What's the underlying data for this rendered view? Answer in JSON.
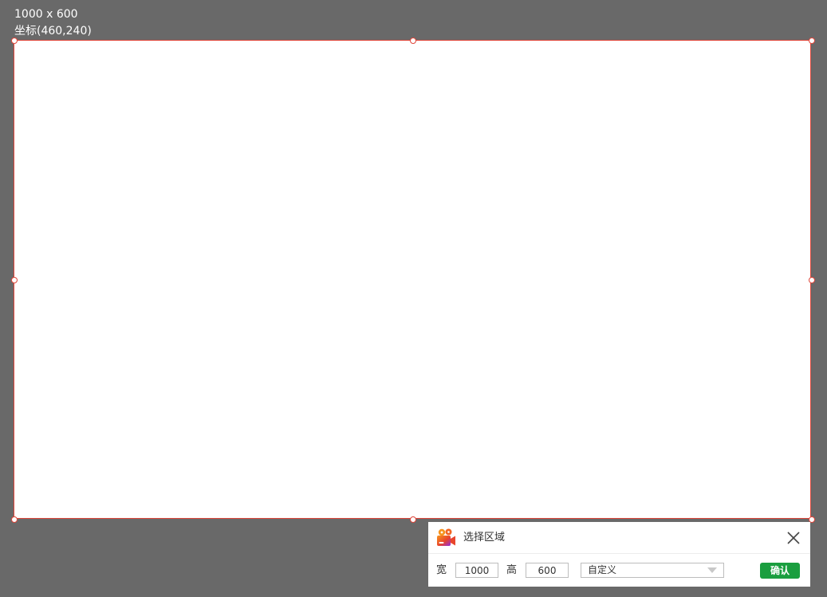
{
  "overlay": {
    "size_text": "1000 x 600",
    "coord_text": "坐标(460,240)",
    "background_color": "#696969",
    "border_color": "#e0463a"
  },
  "panel": {
    "title": "选择区域",
    "width_label": "宽",
    "width_value": "1000",
    "height_label": "高",
    "height_value": "600",
    "preset_selected": "自定义",
    "confirm_label": "确认",
    "confirm_color": "#1a9e3f",
    "logo_icon": "video-camera-logo-icon",
    "close_icon": "close-icon",
    "dropdown_icon": "dropdown-arrow-icon"
  }
}
